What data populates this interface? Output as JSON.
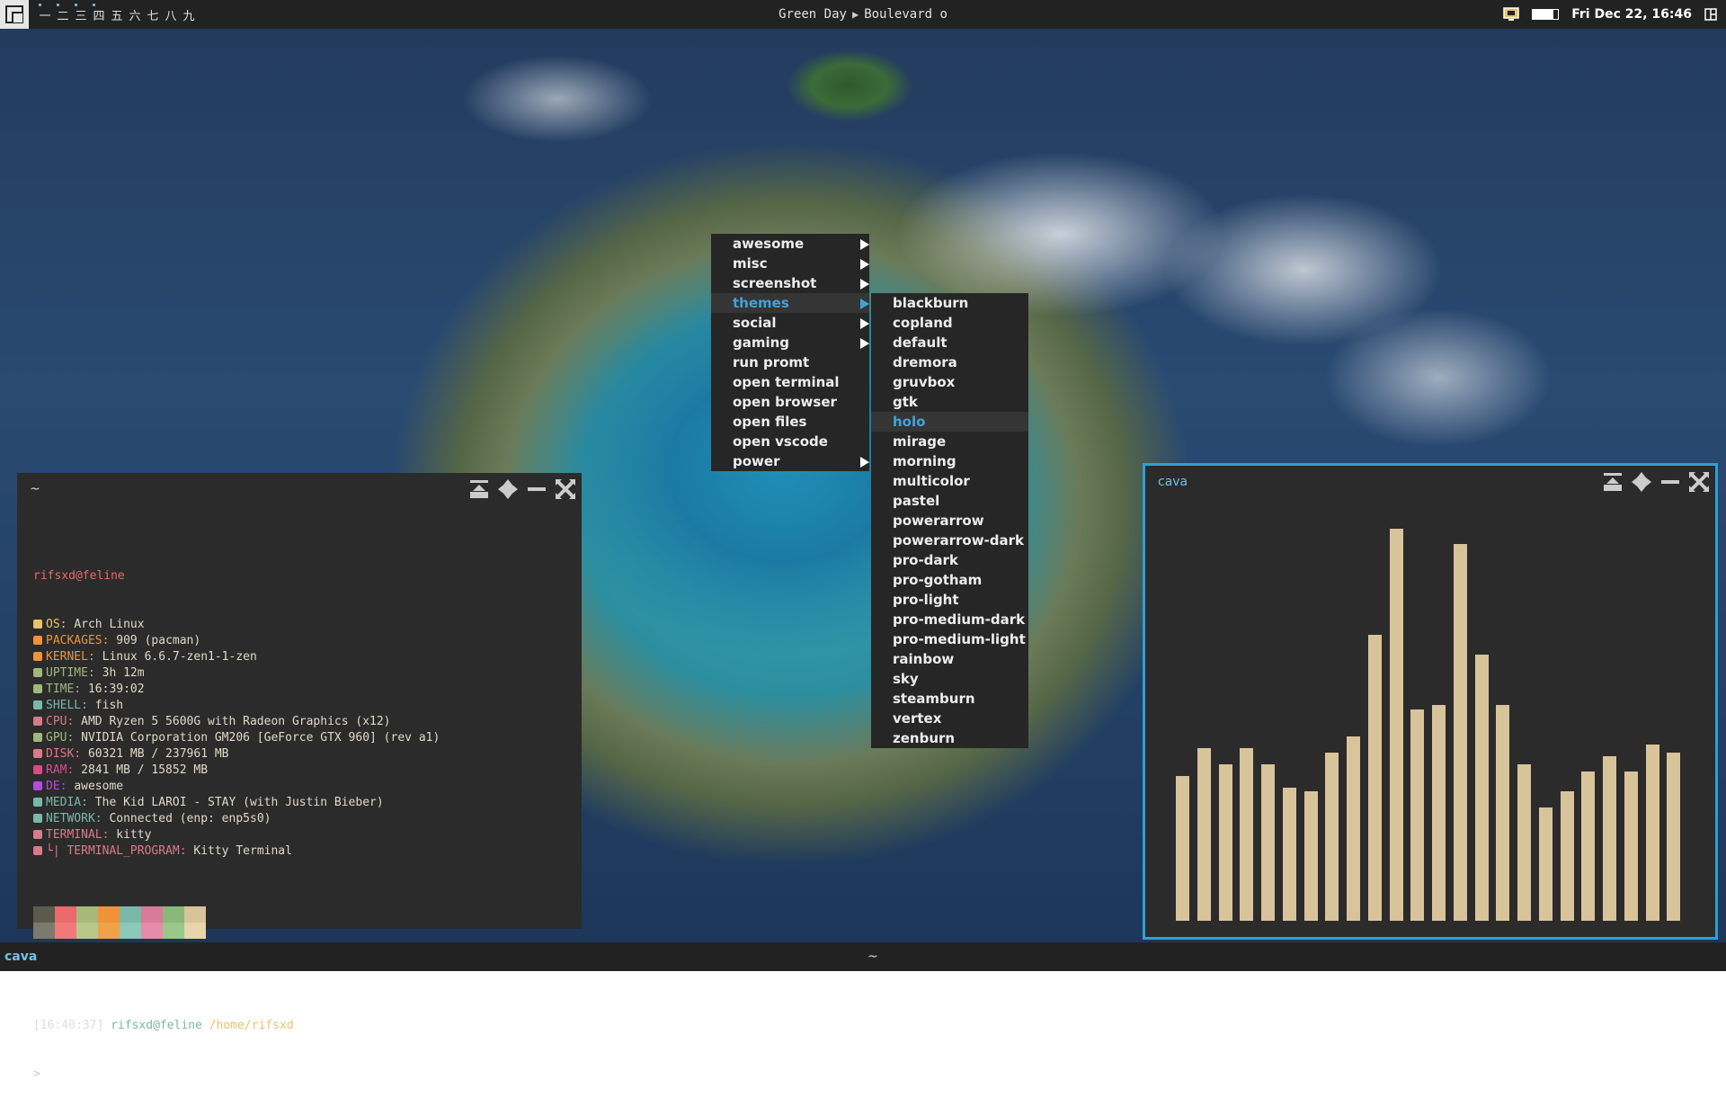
{
  "topbar": {
    "tags": [
      "一",
      "二",
      "三",
      "四",
      "五",
      "六",
      "七",
      "八",
      "九"
    ],
    "used_tags": [
      0,
      1,
      2,
      3
    ],
    "now_playing": {
      "artist": "Green Day",
      "track": "Boulevard o"
    },
    "battery_level": 0.8,
    "clock": "Fri Dec 22, 16:46"
  },
  "menu": {
    "items": [
      {
        "label": "awesome",
        "submenu": true
      },
      {
        "label": "misc",
        "submenu": true
      },
      {
        "label": "screenshot",
        "submenu": true
      },
      {
        "label": "themes",
        "submenu": true,
        "active": true
      },
      {
        "label": "social",
        "submenu": true
      },
      {
        "label": "gaming",
        "submenu": true
      },
      {
        "label": "run promt",
        "submenu": false
      },
      {
        "label": "open terminal",
        "submenu": false
      },
      {
        "label": "open browser",
        "submenu": false
      },
      {
        "label": "open files",
        "submenu": false
      },
      {
        "label": "open vscode",
        "submenu": false
      },
      {
        "label": "power",
        "submenu": true
      }
    ],
    "themes": [
      "blackburn",
      "copland",
      "default",
      "dremora",
      "gruvbox",
      "gtk",
      "holo",
      "mirage",
      "morning",
      "multicolor",
      "pastel",
      "powerarrow",
      "powerarrow-dark",
      "pro-dark",
      "pro-gotham",
      "pro-light",
      "pro-medium-dark",
      "pro-medium-light",
      "rainbow",
      "sky",
      "steamburn",
      "vertex",
      "zenburn"
    ],
    "active_theme": "holo"
  },
  "terminal": {
    "title": "~",
    "user_host": "rifsxd@feline",
    "info": [
      {
        "icon": "monitor-icon",
        "color": "#e8c36a",
        "label": "OS:",
        "value": "Arch Linux"
      },
      {
        "icon": "package-icon",
        "color": "#f0923a",
        "label": "PACKAGES:",
        "value": "909 (pacman)"
      },
      {
        "icon": "penguin-icon",
        "color": "#f0923a",
        "label": "KERNEL:",
        "value": "Linux 6.6.7-zen1-1-zen"
      },
      {
        "icon": "clock-icon",
        "color": "#a0b87a",
        "label": "UPTIME:",
        "value": "3h 12m"
      },
      {
        "icon": "time-icon",
        "color": "#a0b87a",
        "label": "TIME:",
        "value": "16:39:02"
      },
      {
        "icon": "shell-icon",
        "color": "#7ab8a8",
        "label": "SHELL:",
        "value": "fish"
      },
      {
        "icon": "cpu-icon",
        "color": "#d87a8a",
        "label": "CPU:",
        "value": "AMD Ryzen 5 5600G with Radeon Graphics (x12)"
      },
      {
        "icon": "gpu-icon",
        "color": "#a0b87a",
        "label": "GPU:",
        "value": "NVIDIA Corporation GM206 [GeForce GTX 960] (rev a1)"
      },
      {
        "icon": "disk-icon",
        "color": "#d87a8a",
        "label": "DISK:",
        "value": "60321 MB / 237961 MB"
      },
      {
        "icon": "ram-icon",
        "color": "#d84a8a",
        "label": "RAM:",
        "value": "2841 MB / 15852 MB"
      },
      {
        "icon": "desktop-icon",
        "color": "#b44ae0",
        "label": "DE:",
        "value": "awesome"
      },
      {
        "icon": "media-icon",
        "color": "#7ab8a8",
        "label": "MEDIA:",
        "value": "The Kid LAROI - STAY (with Justin Bieber)"
      },
      {
        "icon": "network-icon",
        "color": "#7ab8a8",
        "label": "NETWORK:",
        "value": "Connected (enp: enp5s0)"
      },
      {
        "icon": "terminal-icon",
        "color": "#d87a8a",
        "label": "TERMINAL:",
        "value": "kitty"
      },
      {
        "icon": "terminal-program-icon",
        "color": "#d87a8a",
        "label": "└| TERMINAL_PROGRAM:",
        "value": "Kitty Terminal"
      }
    ],
    "palette_top": [
      "#5a5a4e",
      "#e86a6a",
      "#a8b87a",
      "#f0923a",
      "#7ab8a8",
      "#d87a9a",
      "#8ab87a",
      "#d8c49b"
    ],
    "palette_bottom": [
      "#7a7a6e",
      "#f07a7a",
      "#b8c88a",
      "#f0a24a",
      "#8ac8b8",
      "#e88aaa",
      "#9ac88a",
      "#e8d4ab"
    ],
    "prompt": {
      "time": "[16:40:37]",
      "user": "rifsxd@feline",
      "path": "/home/rifsxd",
      "symbol": ">"
    }
  },
  "cava": {
    "title": "cava",
    "bar_color": "#d8c49b",
    "levels": [
      0.37,
      0.44,
      0.4,
      0.44,
      0.4,
      0.34,
      0.33,
      0.43,
      0.47,
      0.73,
      1.0,
      0.54,
      0.55,
      0.96,
      0.68,
      0.55,
      0.4,
      0.29,
      0.33,
      0.38,
      0.42,
      0.38,
      0.45,
      0.43
    ]
  },
  "taskbar": {
    "left": "cava",
    "middle": "~"
  }
}
